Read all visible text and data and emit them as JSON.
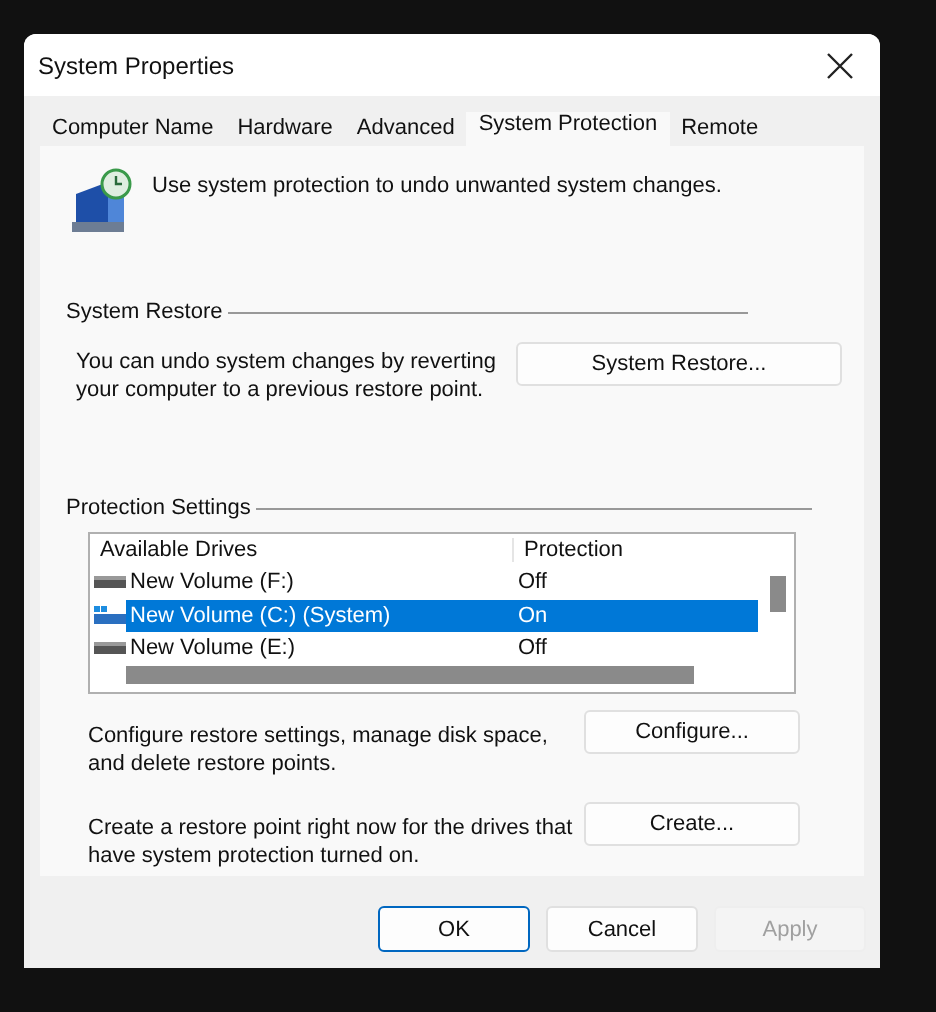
{
  "window": {
    "title": "System Properties"
  },
  "tabs": [
    {
      "label": "Computer Name",
      "selected": false
    },
    {
      "label": "Hardware",
      "selected": false
    },
    {
      "label": "Advanced",
      "selected": false
    },
    {
      "label": "System Protection",
      "selected": true
    },
    {
      "label": "Remote",
      "selected": false
    }
  ],
  "intro": "Use system protection to undo unwanted system changes.",
  "system_restore": {
    "heading": "System Restore",
    "text": "You can undo system changes by reverting your computer to a previous restore point.",
    "button": "System Restore..."
  },
  "protection_settings": {
    "heading": "Protection Settings",
    "columns": [
      "Available Drives",
      "Protection"
    ],
    "rows": [
      {
        "drive": "New Volume (F:)",
        "protection": "Off",
        "kind": "data",
        "selected": false
      },
      {
        "drive": "New Volume (C:) (System)",
        "protection": "On",
        "kind": "system",
        "selected": true
      },
      {
        "drive": "New Volume (E:)",
        "protection": "Off",
        "kind": "data",
        "selected": false
      }
    ],
    "actions": [
      {
        "text": "Configure restore settings, manage disk space, and delete restore points.",
        "button": "Configure..."
      },
      {
        "text": "Create a restore point right now for the drives that have system protection turned on.",
        "button": "Create..."
      }
    ]
  },
  "buttons": [
    {
      "label": "OK",
      "kind": "default",
      "disabled": false
    },
    {
      "label": "Cancel",
      "kind": "normal",
      "disabled": false
    },
    {
      "label": "Apply",
      "kind": "normal",
      "disabled": true
    }
  ]
}
